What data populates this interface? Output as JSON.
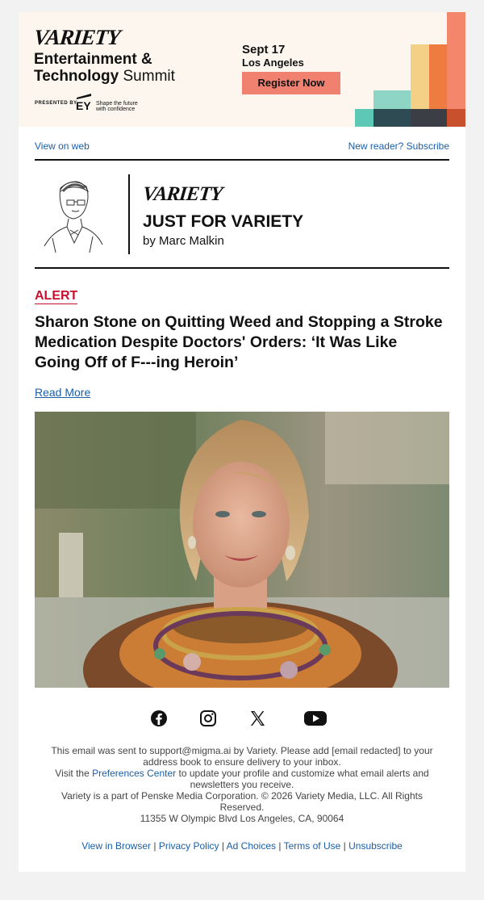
{
  "banner": {
    "logo": "VARIETY",
    "title_line1": "Entertainment &",
    "title_line2_bold": "Technology",
    "title_line2_light": " Summit",
    "presented_by": "PRESENTED BY",
    "sponsor": "EY",
    "sponsor_tagline_1": "Shape the future",
    "sponsor_tagline_2": "with confidence",
    "date": "Sept 17",
    "city": "Los Angeles",
    "cta": "Register Now"
  },
  "top_links": {
    "view_on_web": "View on web",
    "subscribe": "New reader? Subscribe"
  },
  "column": {
    "logo": "VARIETY",
    "title": "JUST FOR VARIETY",
    "byline": "by Marc Malkin"
  },
  "article": {
    "tag": "ALERT",
    "headline": "Sharon Stone on Quitting Weed and Stopping a Stroke Medication Despite Doctors' Orders: ‘It Was Like Going Off of F---ing Heroin’",
    "read_more": "Read More"
  },
  "social": [
    "facebook-icon",
    "instagram-icon",
    "x-icon",
    "youtube-icon"
  ],
  "footer": {
    "line1": "This email was sent to support@migma.ai by Variety. Please add [email redacted] to your address book to ensure delivery to your inbox.",
    "line2_pre": "Visit the ",
    "line2_link": "Preferences Center",
    "line2_post": " to update your profile and customize what email alerts and newsletters you receive.",
    "line3": "Variety is a part of Penske Media Corporation. © 2026 Variety Media, LLC. All Rights Reserved.",
    "line4": "11355 W Olympic Blvd Los Angeles, CA, 90064",
    "links": [
      "View in Browser",
      "Privacy Policy",
      "Ad Choices",
      "Terms of Use",
      "Unsubscribe"
    ],
    "separator": "|"
  },
  "colors": {
    "accent_red": "#c8102e",
    "link_blue": "#1a5fa8",
    "cta_coral": "#f08070"
  }
}
